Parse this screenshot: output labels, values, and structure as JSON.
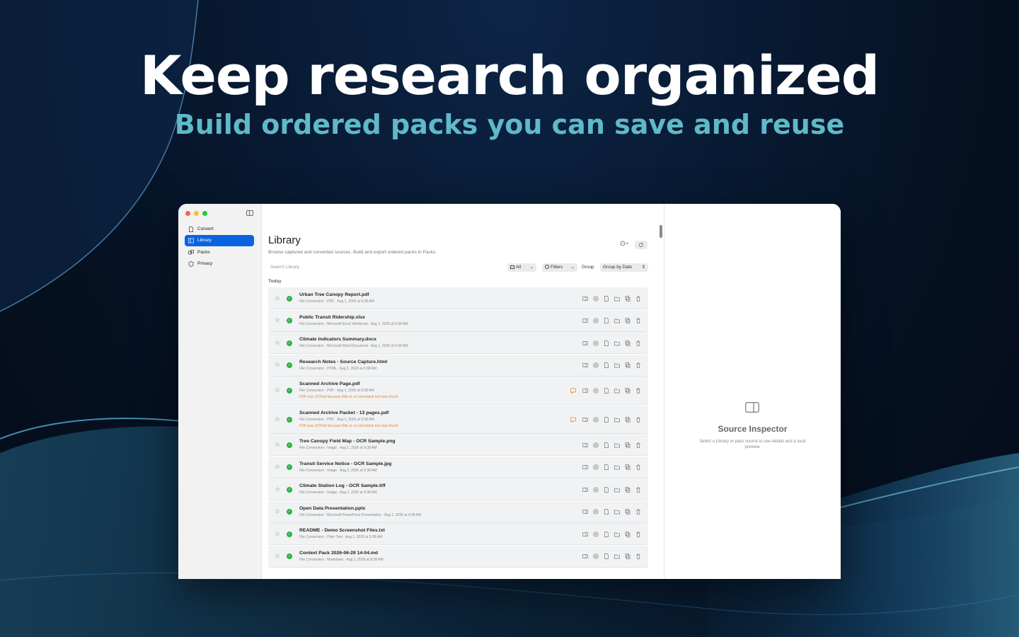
{
  "hero": {
    "title": "Keep research organized",
    "subtitle": "Build ordered packs you can save and reuse"
  },
  "sidebar": {
    "items": [
      {
        "label": "Convert",
        "icon": "document-icon",
        "active": false
      },
      {
        "label": "Library",
        "icon": "library-icon",
        "active": true
      },
      {
        "label": "Packs",
        "icon": "packs-icon",
        "active": false
      },
      {
        "label": "Privacy",
        "icon": "shield-icon",
        "active": false
      }
    ]
  },
  "main": {
    "title": "Library",
    "description": "Browse captured and converted sources. Build and export ordered packs in Packs.",
    "search_placeholder": "Search Library",
    "filter_all": "All",
    "filters_label": "Filters",
    "group_label": "Group",
    "group_value": "Group by Date",
    "section": "Today"
  },
  "rows": [
    {
      "title": "Urban Tree Canopy Report.pdf",
      "meta": "File Conversion · PDF · Aug 1, 2026 at 9:38 AM",
      "warning": ""
    },
    {
      "title": "Public Transit Ridership.xlsx",
      "meta": "File Conversion · Microsoft Excel Workbook · Aug 1, 2026 at 9:38 AM",
      "warning": ""
    },
    {
      "title": "Climate Indicators Summary.docx",
      "meta": "File Conversion · Microsoft Word Document · Aug 1, 2026 at 9:38 AM",
      "warning": ""
    },
    {
      "title": "Research Notes - Source Capture.html",
      "meta": "File Conversion · HTML · Aug 1, 2026 at 9:38 AM",
      "warning": ""
    },
    {
      "title": "Scanned Archive Page.pdf",
      "meta": "File Conversion · PDF · Aug 1, 2026 at 9:38 AM",
      "warning": "PDF was OCRed because little or no selectable text was found"
    },
    {
      "title": "Scanned Archive Packet - 13 pages.pdf",
      "meta": "File Conversion · PDF · Aug 1, 2026 at 9:38 AM",
      "warning": "PDF was OCRed because little or no selectable text was found"
    },
    {
      "title": "Tree Canopy Field Map - OCR Sample.png",
      "meta": "File Conversion · Image · Aug 1, 2026 at 9:38 AM",
      "warning": ""
    },
    {
      "title": "Transit Service Notice - OCR Sample.jpg",
      "meta": "File Conversion · Image · Aug 1, 2026 at 9:38 AM",
      "warning": ""
    },
    {
      "title": "Climate Station Log - OCR Sample.tiff",
      "meta": "File Conversion · Image · Aug 1, 2026 at 9:38 AM",
      "warning": ""
    },
    {
      "title": "Open Data Presentation.pptx",
      "meta": "File Conversion · Microsoft PowerPoint Presentation · Aug 1, 2026 at 9:38 AM",
      "warning": ""
    },
    {
      "title": "README - Demo Screenshot Files.txt",
      "meta": "File Conversion · Plain Text · Aug 1, 2026 at 9:38 AM",
      "warning": ""
    },
    {
      "title": "Context Pack 2026-06-29 14-04.md",
      "meta": "File Conversion · Markdown · Aug 1, 2026 at 9:38 AM",
      "warning": ""
    }
  ],
  "inspector": {
    "title": "Source Inspector",
    "description": "Select a Library or pack source to see details and a local preview."
  },
  "colors": {
    "accent": "#0a64e0",
    "success": "#2bb34a",
    "warning": "#e8892b",
    "subtitle": "#5fb9c9"
  }
}
